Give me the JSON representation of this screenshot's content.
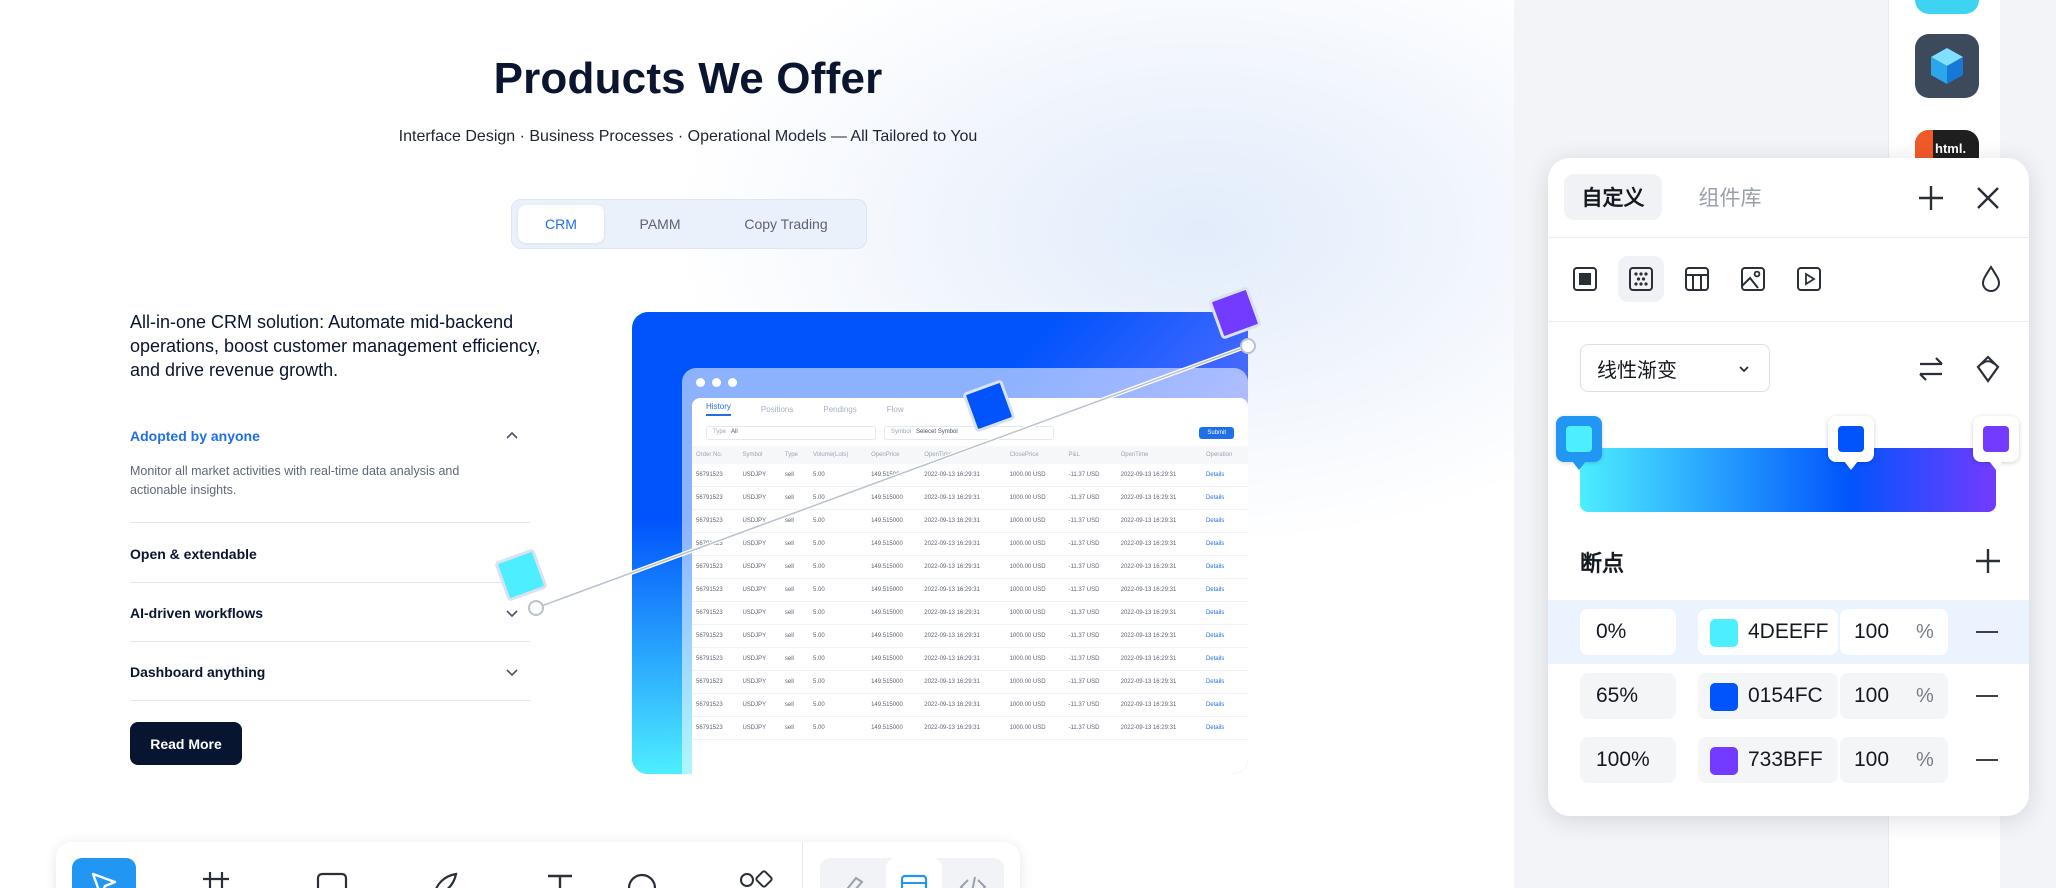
{
  "page": {
    "title": "Products We Offer",
    "subtitle": "Interface Design · Business Processes · Operational Models — All Tailored to You",
    "tabs": [
      "CRM",
      "PAMM",
      "Copy Trading"
    ],
    "lead": "All-in-one CRM solution: Automate mid-backend operations, boost customer management efficiency, and drive revenue growth.",
    "accordion": [
      {
        "title": "Adopted by anyone",
        "desc": "Monitor all market activities with real-time data analysis and actionable insights."
      },
      {
        "title": "Open & extendable"
      },
      {
        "title": "AI-driven workflows"
      },
      {
        "title": "Dashboard anything"
      }
    ],
    "read_more": "Read More"
  },
  "preview": {
    "tabs": [
      "History",
      "Positions",
      "Pendings",
      "Flow"
    ],
    "filters": {
      "type_label": "Type",
      "type_value": "All",
      "symbol_label": "Symbol",
      "symbol_value": "Selecet Symbol",
      "submit": "Submit"
    },
    "columns": [
      "Order No.",
      "Symbol",
      "Type",
      "Volume(Lots)",
      "OpenPrice",
      "OpenTime",
      "ClosePrice",
      "P&L",
      "OpenTime",
      "Operation"
    ],
    "row": [
      "56791523",
      "USDJPY",
      "sell",
      "5.00",
      "149.515000",
      "2022-09-13 16:29:31",
      "1000.00 USD",
      "-11.37 USD",
      "2022-09-13 16:29:31",
      "Details"
    ]
  },
  "panel": {
    "tab_custom": "自定义",
    "tab_library": "组件库",
    "gradient_type": "线性渐变",
    "breakpoints_title": "断点",
    "stops": [
      {
        "position": "0%",
        "hex": "4DEEFF",
        "color": "#4DEEFF",
        "opacity": "100",
        "unit": "%"
      },
      {
        "position": "65%",
        "hex": "0154FC",
        "color": "#0154FC",
        "opacity": "100",
        "unit": "%"
      },
      {
        "position": "100%",
        "hex": "733BFF",
        "color": "#733BFF",
        "opacity": "100",
        "unit": "%"
      }
    ]
  },
  "dock": {
    "app_label": "html. to."
  },
  "icons": [
    "plus-icon",
    "close-icon",
    "solid-fill-icon",
    "noise-icon",
    "pattern-icon",
    "image-icon",
    "video-icon",
    "opacity-drop-icon",
    "swap-icon",
    "rotate-icon",
    "chevron-down-icon",
    "chevron-up-icon",
    "pointer-icon",
    "frame-icon",
    "rectangle-icon",
    "pen-icon",
    "text-icon",
    "ellipse-icon",
    "components-icon"
  ]
}
